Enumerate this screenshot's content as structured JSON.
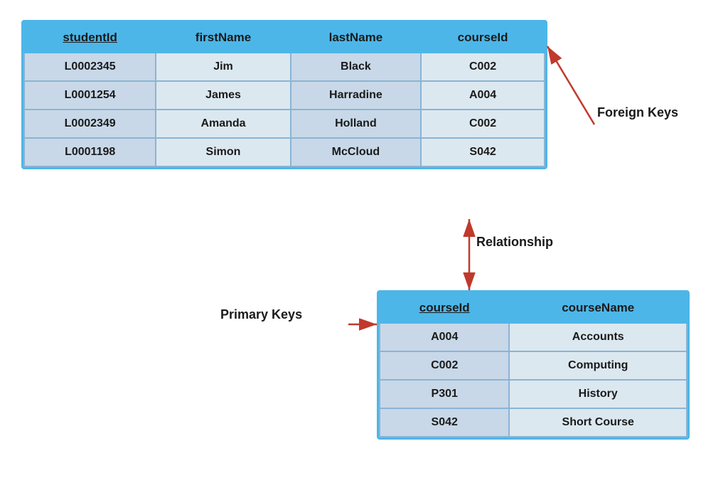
{
  "student_table": {
    "columns": [
      "studentId",
      "firstName",
      "lastName",
      "courseId"
    ],
    "pk_col": "studentId",
    "rows": [
      [
        "L0002345",
        "Jim",
        "Black",
        "C002"
      ],
      [
        "L0001254",
        "James",
        "Harradine",
        "A004"
      ],
      [
        "L0002349",
        "Amanda",
        "Holland",
        "C002"
      ],
      [
        "L0001198",
        "Simon",
        "McCloud",
        "S042"
      ]
    ]
  },
  "course_table": {
    "columns": [
      "courseId",
      "courseName"
    ],
    "pk_col": "courseId",
    "rows": [
      [
        "A004",
        "Accounts"
      ],
      [
        "C002",
        "Computing"
      ],
      [
        "P301",
        "History"
      ],
      [
        "S042",
        "Short Course"
      ]
    ]
  },
  "labels": {
    "foreign_keys": "Foreign Keys",
    "relationship": "Relationship",
    "primary_keys": "Primary Keys"
  }
}
